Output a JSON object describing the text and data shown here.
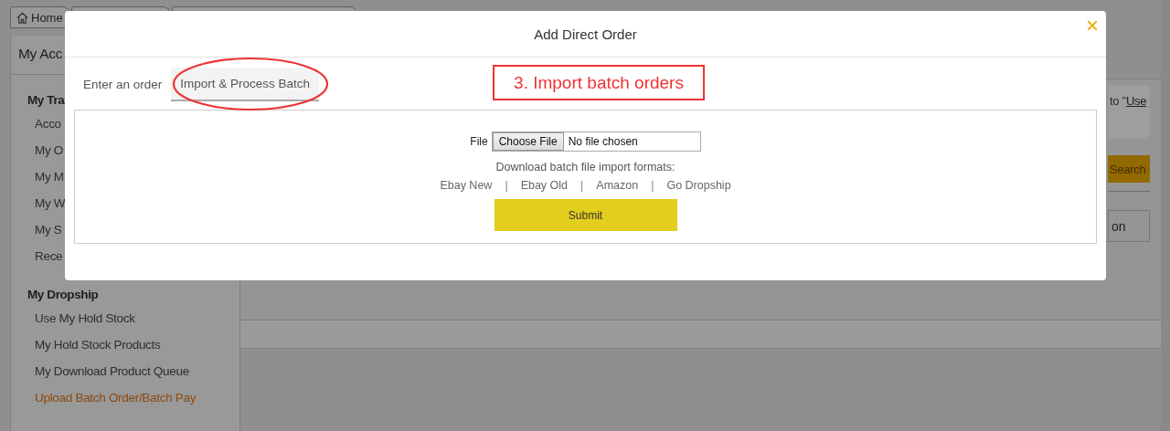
{
  "breadcrumb": [
    {
      "label": "Home",
      "kind": "home"
    },
    {
      "kind": "blank"
    },
    {
      "kind": "blank"
    }
  ],
  "sidebar": {
    "title": "My Acc",
    "sections": [
      {
        "title": "My Tra",
        "items": [
          {
            "label": "Acco",
            "selected": false
          },
          {
            "label": "My O",
            "selected": false
          },
          {
            "label": "My M",
            "selected": false
          },
          {
            "label": "My W",
            "selected": false
          },
          {
            "label": "My S",
            "selected": false
          },
          {
            "label": "Rece",
            "selected": false
          }
        ]
      },
      {
        "title": "My Dropship",
        "items": [
          {
            "label": "Use My Hold Stock",
            "selected": false
          },
          {
            "label": "My Hold Stock Products",
            "selected": false
          },
          {
            "label": "My Download Product Queue",
            "selected": false
          },
          {
            "label": "Upload Batch Order/Batch Pay",
            "selected": true
          }
        ]
      }
    ]
  },
  "main": {
    "notice": "to \"",
    "notice_link": "Use",
    "search_button": "Search",
    "button_2": "on"
  },
  "modal": {
    "title": "Add Direct Order",
    "close": "×",
    "tabs": [
      {
        "label": "Enter an order",
        "selected": false
      },
      {
        "label": "Import & Process Batch",
        "selected": true
      }
    ],
    "annotation": "3. Import batch orders",
    "file_label": "File",
    "file_button": "Choose File",
    "file_status": "No file chosen",
    "formats_label": "Download batch file import formats:",
    "formats": [
      {
        "kind": "link",
        "label": "Ebay New"
      },
      {
        "kind": "separator",
        "label": "|"
      },
      {
        "kind": "link",
        "label": "Ebay Old"
      },
      {
        "kind": "separator",
        "label": "|"
      },
      {
        "kind": "link",
        "label": "Amazon"
      },
      {
        "kind": "separator",
        "label": "|"
      },
      {
        "kind": "link",
        "label": "Go Dropship"
      }
    ],
    "submit": "Submit"
  }
}
